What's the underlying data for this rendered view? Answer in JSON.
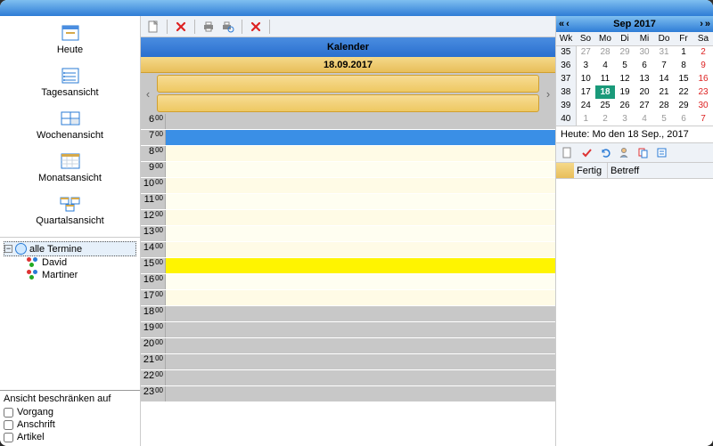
{
  "views": {
    "today": "Heute",
    "day": "Tagesansicht",
    "week": "Wochenansicht",
    "month": "Monatsansicht",
    "quarter": "Quartalsansicht"
  },
  "tree": {
    "root": "alle Termine",
    "children": [
      "David",
      "Martiner"
    ]
  },
  "filter": {
    "title": "Ansicht beschränken auf",
    "vorgang": "Vorgang",
    "anschrift": "Anschrift",
    "artikel": "Artikel"
  },
  "calendar": {
    "title": "Kalender",
    "date": "18.09.2017",
    "hours": [
      "6",
      "7",
      "8",
      "9",
      "10",
      "11",
      "12",
      "13",
      "14",
      "15",
      "16",
      "17",
      "18",
      "19",
      "20",
      "21",
      "22",
      "23"
    ]
  },
  "minical": {
    "title": "Sep 2017",
    "weekdays": [
      "Wk",
      "So",
      "Mo",
      "Di",
      "Mi",
      "Do",
      "Fr",
      "Sa"
    ],
    "weeks": [
      {
        "wk": "35",
        "d": [
          {
            "v": "27",
            "o": 1
          },
          {
            "v": "28",
            "o": 1
          },
          {
            "v": "29",
            "o": 1
          },
          {
            "v": "30",
            "o": 1
          },
          {
            "v": "31",
            "o": 1
          },
          {
            "v": "1"
          },
          {
            "v": "2",
            "s": 1
          }
        ]
      },
      {
        "wk": "36",
        "d": [
          {
            "v": "3"
          },
          {
            "v": "4"
          },
          {
            "v": "5"
          },
          {
            "v": "6"
          },
          {
            "v": "7"
          },
          {
            "v": "8"
          },
          {
            "v": "9",
            "s": 1
          }
        ]
      },
      {
        "wk": "37",
        "d": [
          {
            "v": "10"
          },
          {
            "v": "11"
          },
          {
            "v": "12"
          },
          {
            "v": "13"
          },
          {
            "v": "14"
          },
          {
            "v": "15"
          },
          {
            "v": "16",
            "s": 1
          }
        ]
      },
      {
        "wk": "38",
        "d": [
          {
            "v": "17"
          },
          {
            "v": "18",
            "t": 1
          },
          {
            "v": "19"
          },
          {
            "v": "20"
          },
          {
            "v": "21"
          },
          {
            "v": "22"
          },
          {
            "v": "23",
            "s": 1
          }
        ]
      },
      {
        "wk": "39",
        "d": [
          {
            "v": "24"
          },
          {
            "v": "25"
          },
          {
            "v": "26"
          },
          {
            "v": "27"
          },
          {
            "v": "28"
          },
          {
            "v": "29"
          },
          {
            "v": "30",
            "s": 1
          }
        ]
      },
      {
        "wk": "40",
        "d": [
          {
            "v": "1",
            "o": 1
          },
          {
            "v": "2",
            "o": 1
          },
          {
            "v": "3",
            "o": 1
          },
          {
            "v": "4",
            "o": 1
          },
          {
            "v": "5",
            "o": 1
          },
          {
            "v": "6",
            "o": 1
          },
          {
            "v": "7",
            "o": 1,
            "s": 1
          }
        ]
      }
    ],
    "footer": "Heute: Mo den 18 Sep., 2017"
  },
  "tasks": {
    "col_done": "Fertig",
    "col_subject": "Betreff"
  },
  "hour_styles": {
    "6": "off",
    "7": "current",
    "8": "light",
    "9": "alt",
    "10": "light",
    "11": "alt",
    "12": "light",
    "13": "alt",
    "14": "light",
    "15": "highlight",
    "16": "alt",
    "17": "light",
    "18": "off",
    "19": "off",
    "20": "off",
    "21": "off",
    "22": "off",
    "23": "off"
  }
}
